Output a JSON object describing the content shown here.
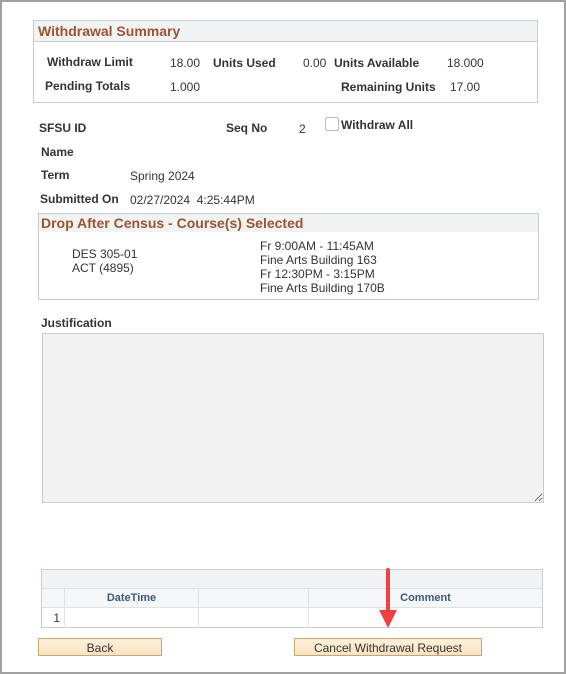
{
  "summary": {
    "title": "Withdrawal Summary",
    "withdraw_limit_label": "Withdraw Limit",
    "withdraw_limit_value": "18.00",
    "units_used_label": "Units Used",
    "units_used_value": "0.00",
    "units_available_label": "Units Available",
    "units_available_value": "18.000",
    "pending_totals_label": "Pending Totals",
    "pending_totals_value": "1.000",
    "remaining_units_label": "Remaining Units",
    "remaining_units_value": "17.00"
  },
  "info": {
    "sfsu_id_label": "SFSU ID",
    "sfsu_id_value": "",
    "seq_no_label": "Seq No",
    "seq_no_value": "2",
    "withdraw_all_label": "Withdraw All",
    "withdraw_all_checked": false,
    "name_label": "Name",
    "name_value": "",
    "term_label": "Term",
    "term_value": "Spring 2024",
    "submitted_label": "Submitted On",
    "submitted_value": "02/27/2024  4:25:44PM"
  },
  "courses": {
    "title": "Drop After Census - Course(s) Selected",
    "course_code": "DES 305-01",
    "course_type": "ACT (4895)",
    "schedule": [
      "Fr 9:00AM - 11:45AM",
      "Fine Arts Building 163",
      "Fr 12:30PM - 3:15PM",
      "Fine Arts Building 170B"
    ]
  },
  "justification": {
    "label": "Justification",
    "value": ""
  },
  "comments_grid": {
    "columns": [
      "",
      "DateTime",
      "",
      "Comment"
    ],
    "rows": [
      {
        "num": "1",
        "datetime": "",
        "extra": "",
        "comment": ""
      }
    ]
  },
  "buttons": {
    "back": "Back",
    "cancel": "Cancel Withdrawal Request"
  },
  "annotation": {
    "arrow_color": "#f04040"
  }
}
